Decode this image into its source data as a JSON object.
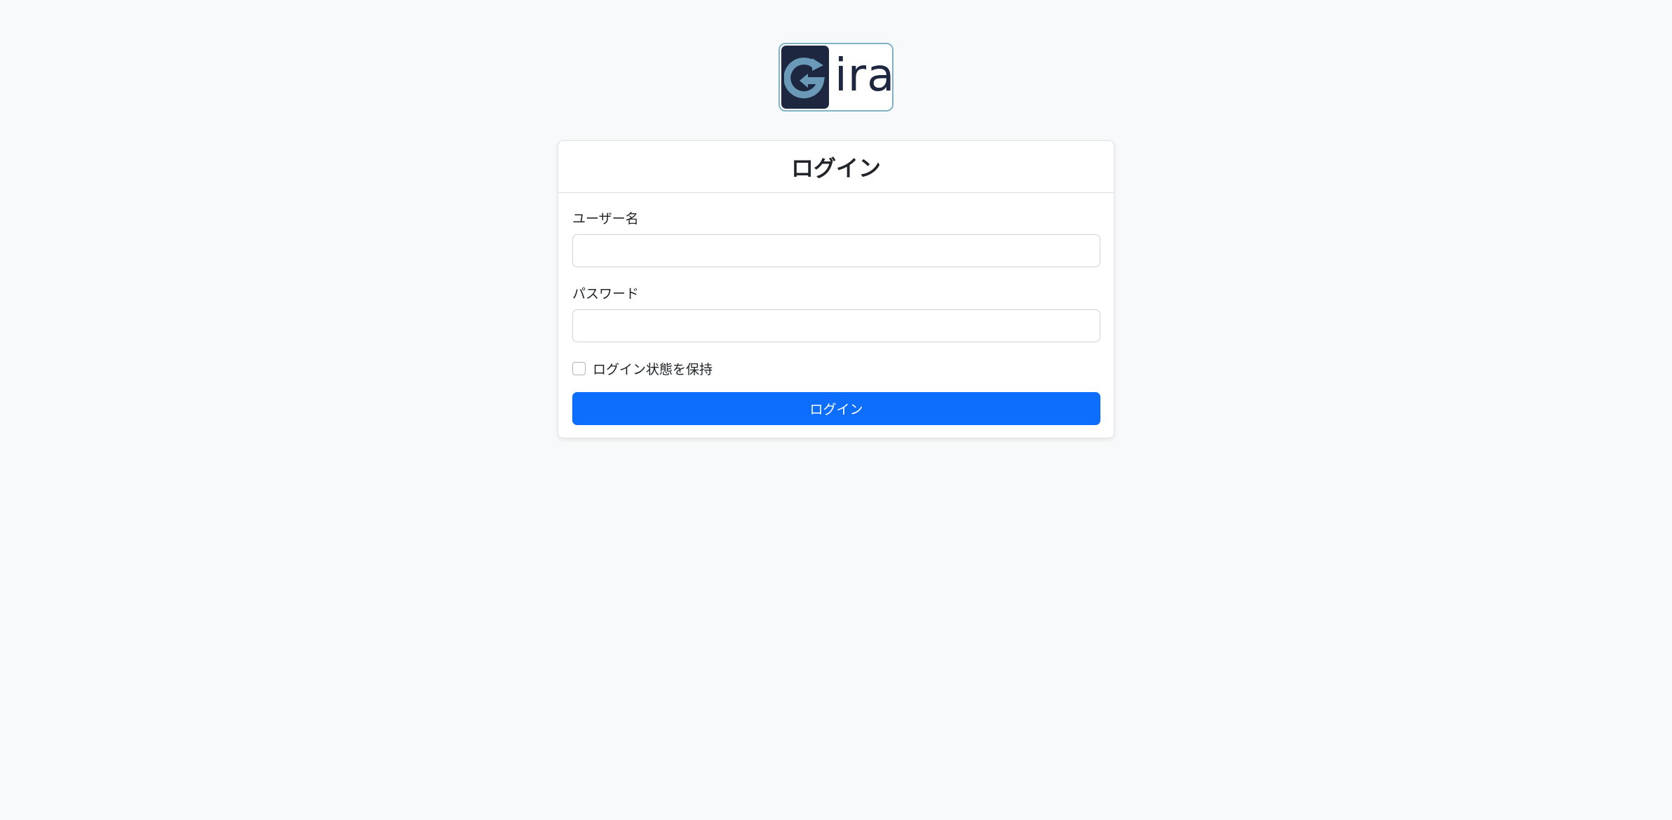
{
  "brand": {
    "logo_text": "ira",
    "colors": {
      "tile": "#1d2740",
      "g_mark": "#6a9ab8",
      "frame": "#7fb3c3"
    }
  },
  "login_card": {
    "title": "ログイン",
    "username_label": "ユーザー名",
    "username_value": "",
    "username_placeholder": "",
    "password_label": "パスワード",
    "password_value": "",
    "password_placeholder": "",
    "remember_label": "ログイン状態を保持",
    "remember_checked": false,
    "submit_label": "ログイン"
  },
  "colors": {
    "page_background": "#f8f9fa",
    "primary": "#0d6efd",
    "border": "#dee2e6"
  }
}
